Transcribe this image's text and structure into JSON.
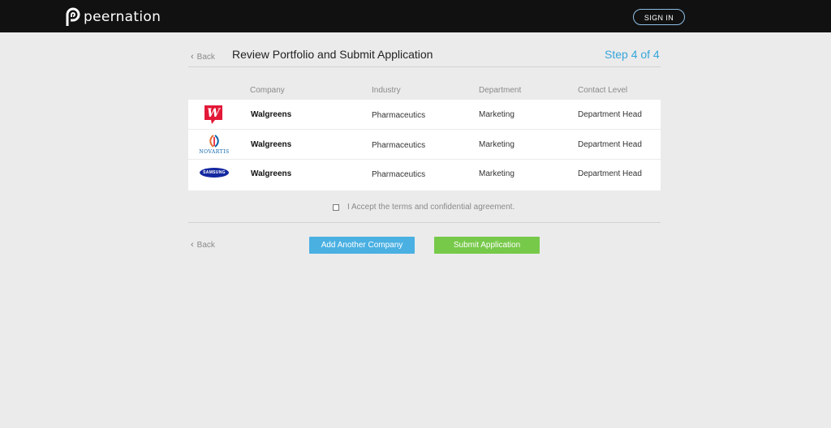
{
  "header": {
    "brand": "peernation",
    "sign_in_label": "SIGN IN"
  },
  "page": {
    "back_label": "Back",
    "title": "Review Portfolio and Submit Application",
    "step": "Step 4 of 4"
  },
  "table": {
    "columns": [
      "Company",
      "Industry",
      "Department",
      "Contact Level"
    ],
    "rows": [
      {
        "logo": "walgreens-logo",
        "company": "Walgreens",
        "industry": "Pharmaceutics",
        "department": "Marketing",
        "contact_level": "Department Head"
      },
      {
        "logo": "novartis-logo",
        "logo_text": "NOVARTIS",
        "company": "Walgreens",
        "industry": "Pharmaceutics",
        "department": "Marketing",
        "contact_level": "Department Head"
      },
      {
        "logo": "samsung-logo",
        "logo_text": "SAMSUNG",
        "company": "Walgreens",
        "industry": "Pharmaceutics",
        "department": "Marketing",
        "contact_level": "Department Head"
      }
    ]
  },
  "terms": {
    "label": "I Accept the terms and confidential agreement.",
    "checked": false
  },
  "footer": {
    "back_label": "Back",
    "add_company_label": "Add Another Company",
    "submit_label": "Submit Application"
  },
  "colors": {
    "topbar": "#111111",
    "accent_blue": "#36a6d8",
    "add_button": "#4ab0e2",
    "submit_button": "#77c94a",
    "walgreens_red": "#e31837",
    "samsung_blue": "#1428a0"
  }
}
